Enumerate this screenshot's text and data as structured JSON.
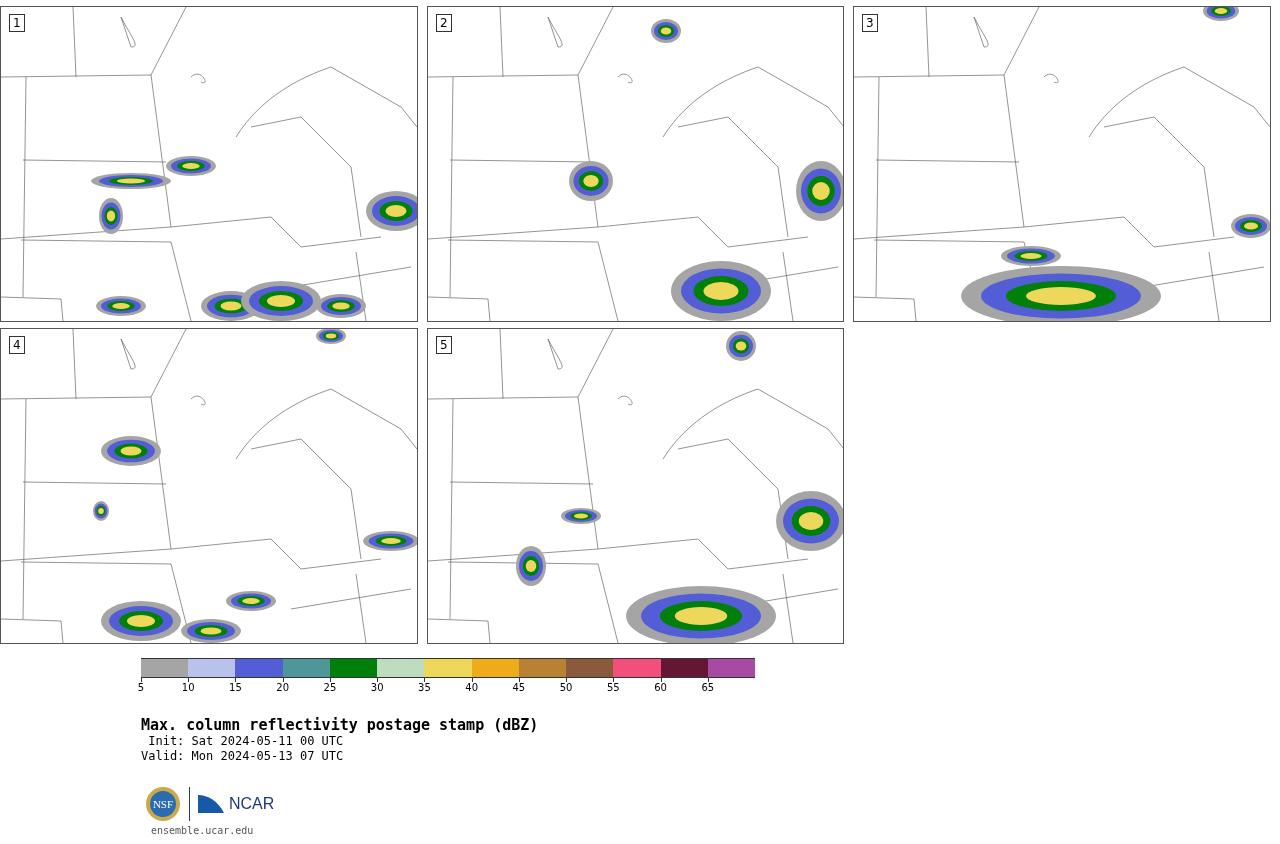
{
  "panels": [
    {
      "label": "1"
    },
    {
      "label": "2"
    },
    {
      "label": "3"
    },
    {
      "label": "4"
    },
    {
      "label": "5"
    }
  ],
  "colorbar": {
    "bins": [
      {
        "color": "#a5a5a5",
        "label": "5"
      },
      {
        "color": "#b8c2ec",
        "label": "10"
      },
      {
        "color": "#535ed6",
        "label": "15"
      },
      {
        "color": "#4f969b",
        "label": "20"
      },
      {
        "color": "#00800a",
        "label": "25"
      },
      {
        "color": "#bfdcbf",
        "label": "30"
      },
      {
        "color": "#eed85c",
        "label": "35"
      },
      {
        "color": "#eeac1a",
        "label": "40"
      },
      {
        "color": "#b88232",
        "label": "45"
      },
      {
        "color": "#8a5a3c",
        "label": "50"
      },
      {
        "color": "#f2507b",
        "label": "55"
      },
      {
        "color": "#641634",
        "label": "60"
      },
      {
        "color": "#a84aa4",
        "label": "65"
      }
    ]
  },
  "title": "Max. column reflectivity postage stamp (dBZ)",
  "init": " Init: Sat 2024-05-11 00 UTC",
  "valid": "Valid: Mon 2024-05-13 07 UTC",
  "logos": {
    "nsf": "NSF",
    "ncar": "NCAR"
  },
  "footer_link": "ensemble.ucar.edu"
}
